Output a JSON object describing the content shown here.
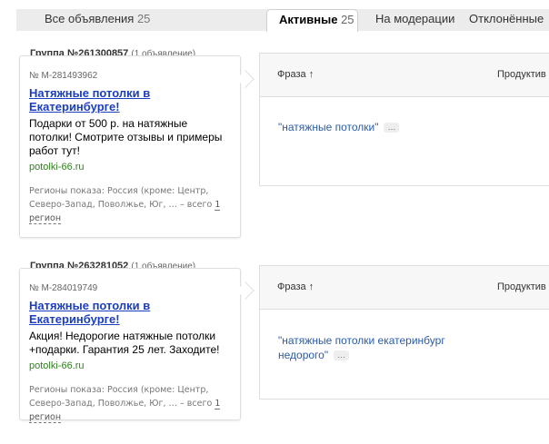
{
  "tabs": {
    "all": {
      "label": "Все объявления",
      "count": "25"
    },
    "active": {
      "label": "Активные",
      "count": "25"
    },
    "moderation": {
      "label": "На модерации"
    },
    "rejected": {
      "label": "Отклонённые"
    }
  },
  "groups": [
    {
      "title": "Группа №261300857",
      "subtitle": "(1 объявление)",
      "ad": {
        "number": "№ M-281493962",
        "title": "Натяжные потолки в Екатеринбурге!",
        "text": "Подарки от 500 р. на натяжные потолки! Смотрите отзывы и примеры работ тут!",
        "domain": "potolki-66.ru",
        "regions_prefix": "Регионы показа: Россия (кроме: Центр, Северо-Запад, Поволжье, Юг, … – всего",
        "regions_link": "1 регион"
      },
      "panel": {
        "col_phrase": "Фраза ↑",
        "col_product": "Продуктив",
        "phrase": "\"натяжные потолки\"",
        "more": "…"
      }
    },
    {
      "title": "Группа №263281052",
      "subtitle": "(1 объявление)",
      "ad": {
        "number": "№ M-284019749",
        "title": "Натяжные потолки в Екатеринбурге!",
        "text": "Акция! Недорогие натяжные потолки +подарки. Гарантия 25 лет. Заходите!",
        "domain": "potolki-66.ru",
        "regions_prefix": "Регионы показа: Россия (кроме: Центр, Северо-Запад, Поволжье, Юг, … – всего",
        "regions_link": "1 регион"
      },
      "panel": {
        "col_phrase": "Фраза ↑",
        "col_product": "Продуктив",
        "phrase": "\"натяжные потолки екатеринбург недорого\"",
        "more": "…"
      }
    }
  ],
  "colors": {
    "link": "#1a3dc1",
    "phrase": "#2a5ba8",
    "domain": "#2f7f1f",
    "tab_bar": "#ececec"
  }
}
